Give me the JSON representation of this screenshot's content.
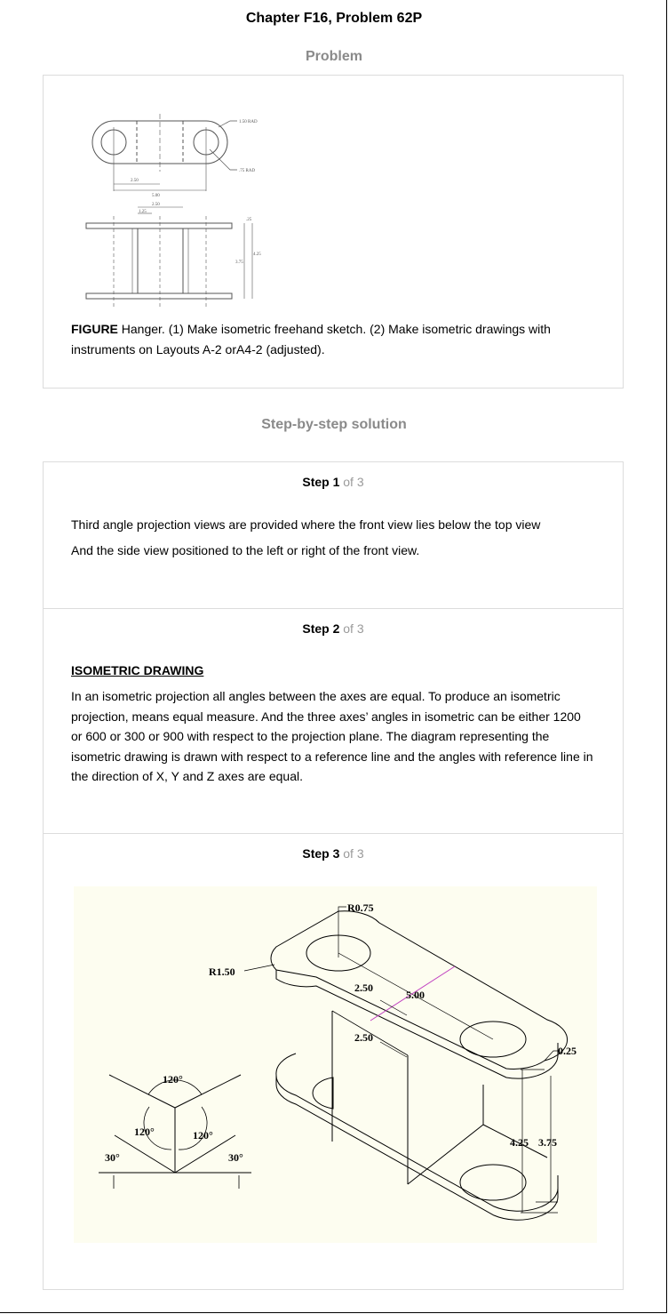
{
  "title": "Chapter F16, Problem 62P",
  "problem_heading": "Problem",
  "figure": {
    "label": "FIGURE",
    "caption": " Hanger. (1) Make isometric freehand sketch. (2) Make isometric drawings with instruments on Layouts A-2 orA4-2 (adjusted).",
    "dimensions": {
      "rad_150": "1.50 RAD",
      "rad_75": ".75 RAD",
      "d250": "2.50",
      "d500": "5.00",
      "d250b": "2.50",
      "d125": "1.25",
      "d25": ".25",
      "d425": "4.25",
      "d375": "3.75"
    }
  },
  "solution_heading": "Step-by-step solution",
  "steps": [
    {
      "label": "Step 1",
      "of": " of 3",
      "lines": [
        "Third angle projection views are provided where the front view lies below the top view",
        "And the side view positioned to the left or right of the front view."
      ]
    },
    {
      "label": "Step 2",
      "of": " of 3",
      "heading": "ISOMETRIC DRAWING",
      "paragraph": "In an isometric projection all angles between the axes are equal. To produce an isometric projection, means equal measure. And the three axes’ angles in isometric can be either 1200 or 600 or 300 or 900 with respect to the projection plane. The diagram representing the isometric drawing is drawn with respect to a reference line and the angles with reference line in the direction of X, Y and Z axes are equal."
    },
    {
      "label": "Step 3",
      "of": " of 3",
      "labels": {
        "r075": "R0.75",
        "r150": "R1.50",
        "d250a": "2.50",
        "d500": "5.00",
        "d250b": "2.50",
        "d025": "0.25",
        "d425": "4.25",
        "d375": "3.75",
        "a120top": "120°",
        "a120left": "120°",
        "a120right": "120°",
        "a30left": "30°",
        "a30right": "30°"
      }
    }
  ]
}
